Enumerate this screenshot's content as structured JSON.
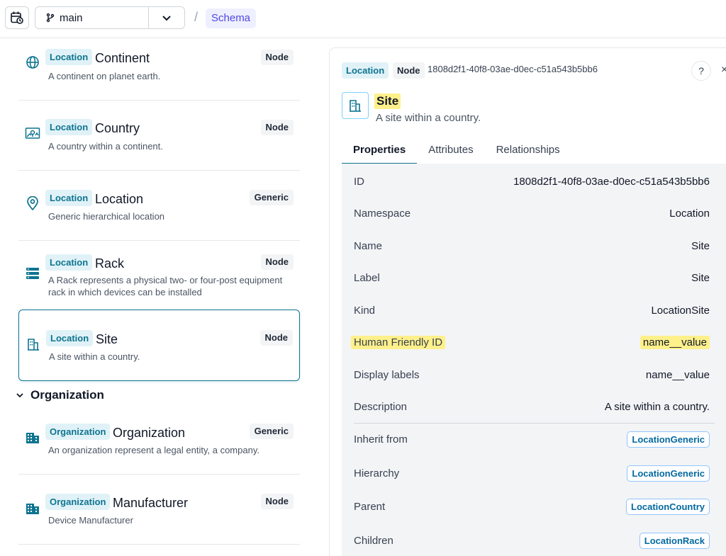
{
  "topbar": {
    "branch_name": "main",
    "breadcrumb_separator": "/",
    "breadcrumb_current": "Schema"
  },
  "list": {
    "items": [
      {
        "namespace": "Location",
        "title": "Continent",
        "desc": "A continent on planet earth.",
        "type": "Node",
        "icon": "globe-icon"
      },
      {
        "namespace": "Location",
        "title": "Country",
        "desc": "A country within a continent.",
        "type": "Node",
        "icon": "map-icon"
      },
      {
        "namespace": "Location",
        "title": "Location",
        "desc": "Generic hierarchical location",
        "type": "Generic",
        "icon": "map-pin-icon"
      },
      {
        "namespace": "Location",
        "title": "Rack",
        "desc": "A Rack represents a physical two- or four-post equipment rack in which devices can be installed",
        "type": "Node",
        "icon": "server-icon"
      },
      {
        "namespace": "Location",
        "title": "Site",
        "desc": "A site within a country.",
        "type": "Node",
        "icon": "building-icon"
      }
    ],
    "group_title": "Organization",
    "org_items": [
      {
        "namespace": "Organization",
        "title": "Organization",
        "desc": "An organization represent a legal entity, a company.",
        "type": "Generic",
        "icon": "office-building-icon"
      },
      {
        "namespace": "Organization",
        "title": "Manufacturer",
        "desc": "Device Manufacturer",
        "type": "Node",
        "icon": "office-building-icon"
      }
    ]
  },
  "detail": {
    "namespace_badge": "Location",
    "kind_badge": "Node",
    "id": "1808d2f1-40f8-03ae-d0ec-c51a543b5bb6",
    "help_label": "?",
    "close_label": "×",
    "title": "Site",
    "subtitle": "A site within a country.",
    "tabs": [
      "Properties",
      "Attributes",
      "Relationships"
    ],
    "properties": [
      {
        "key": "ID",
        "value": "1808d2f1-40f8-03ae-d0ec-c51a543b5bb6"
      },
      {
        "key": "Namespace",
        "value": "Location"
      },
      {
        "key": "Name",
        "value": "Site"
      },
      {
        "key": "Label",
        "value": "Site"
      },
      {
        "key": "Kind",
        "value": "LocationSite"
      },
      {
        "key": "Human Friendly ID",
        "value": "name__value"
      },
      {
        "key": "Display labels",
        "value": "name__value"
      },
      {
        "key": "Description",
        "value": "A site within a country."
      }
    ],
    "links": [
      {
        "key": "Inherit from",
        "value": "LocationGeneric"
      },
      {
        "key": "Hierarchy",
        "value": "LocationGeneric"
      },
      {
        "key": "Parent",
        "value": "LocationCountry"
      },
      {
        "key": "Children",
        "value": "LocationRack"
      }
    ]
  },
  "colors": {
    "accent": "#0e7490",
    "highlight": "#fef08a",
    "schema_crumb": "#4f46e5"
  }
}
